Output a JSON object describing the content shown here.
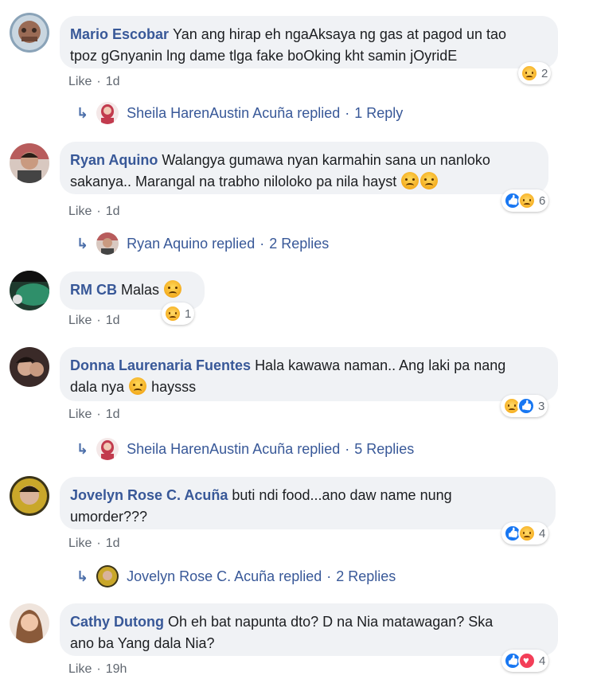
{
  "comments": [
    {
      "author": "Mario Escobar",
      "text_lines": [
        "Yan ang hirap eh ngaAksaya ng gas at pagod un tao",
        "tpoz gGnyanin lng dame tlga fake boOking kht samin jOyridE"
      ],
      "like_label": "Like",
      "time": "1d",
      "reaction_count": "2",
      "reply": {
        "name": "Sheila HarenAustin Acuña replied",
        "count": "1 Reply"
      }
    },
    {
      "author": "Ryan Aquino",
      "text_lines": [
        "Walangya gumawa nyan karmahin sana un nanloko",
        "sakanya.. Marangal na trabho niloloko pa nila hayst"
      ],
      "like_label": "Like",
      "time": "1d",
      "reaction_count": "6",
      "reply": {
        "name": "Ryan Aquino replied",
        "count": "2 Replies"
      }
    },
    {
      "author": "RM CB",
      "text_lines": [
        "Malas"
      ],
      "like_label": "Like",
      "time": "1d",
      "reaction_count": "1"
    },
    {
      "author": "Donna Laurenaria Fuentes",
      "text_lines": [
        "Hala kawawa naman.. Ang laki pa nang",
        "dala nya",
        "haysss"
      ],
      "like_label": "Like",
      "time": "1d",
      "reaction_count": "3",
      "reply": {
        "name": "Sheila HarenAustin Acuña replied",
        "count": "5 Replies"
      }
    },
    {
      "author": "Jovelyn Rose C. Acuña",
      "text_lines": [
        "buti ndi food...ano daw name nung",
        "umorder???"
      ],
      "like_label": "Like",
      "time": "1d",
      "reaction_count": "4",
      "reply": {
        "name": "Jovelyn Rose C. Acuña replied",
        "count": "2 Replies"
      }
    },
    {
      "author": "Cathy Dutong",
      "text_lines": [
        "Oh eh bat napunta dto? D na Nia matawagan? Ska",
        "ano ba Yang dala Nia?"
      ],
      "like_label": "Like",
      "time": "19h",
      "reaction_count": "4"
    }
  ],
  "separator": "·",
  "icons": {
    "reply_arrow": "reply-arrow-icon",
    "reactions": [
      "sad-reaction-icon",
      "like-reaction-icon",
      "love-reaction-icon"
    ]
  },
  "colors": {
    "link": "#385898",
    "bubble": "#f0f2f5",
    "meta": "#606770"
  }
}
